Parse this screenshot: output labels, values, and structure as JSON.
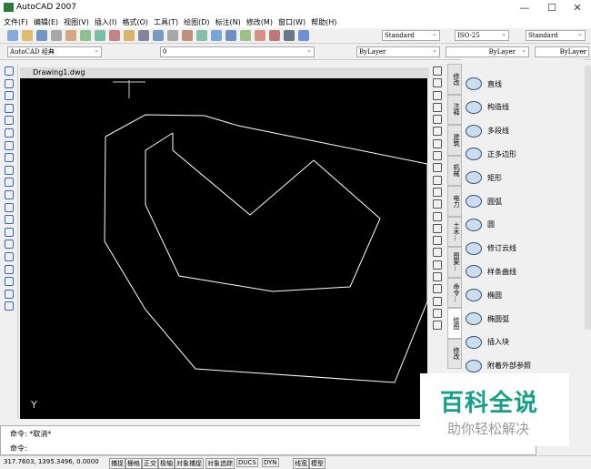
{
  "window": {
    "title": "AutoCAD 2007",
    "minimize": "—",
    "maximize": "☐",
    "close": "✕"
  },
  "menu": [
    "文件(F)",
    "编辑(E)",
    "视图(V)",
    "插入(I)",
    "格式(O)",
    "工具(T)",
    "绘图(D)",
    "标注(N)",
    "修改(M)",
    "窗口(W)",
    "帮助(H)"
  ],
  "toolbar": {
    "text_style": "Standard",
    "dim_style": "ISO-25",
    "table_style": "Standard",
    "workspace": "AutoCAD 经典",
    "layer": "0",
    "color": "ByLayer",
    "linetype": "ByLayer",
    "lineweight": "ByLayer"
  },
  "document": {
    "tab": "Drawing1.dwg",
    "ucs_y": "Y"
  },
  "palette": {
    "tabs": [
      "修改",
      "注释",
      "建筑",
      "机械",
      "电力",
      "土木...",
      "图案...",
      "命令...",
      "绘图",
      "修改"
    ],
    "active_tab": "绘图",
    "items": [
      "直线",
      "构造线",
      "多段线",
      "正多边形",
      "矩形",
      "圆弧",
      "圆",
      "修订云线",
      "样条曲线",
      "椭圆",
      "椭圆弧",
      "插入块",
      "附着外部参照"
    ]
  },
  "command": {
    "history": "命令: *取消*",
    "prompt": "命令:"
  },
  "status": {
    "coords": "317.7603,  1395.3496, 0.0000",
    "buttons": [
      "捕捉",
      "栅格",
      "正交",
      "极轴",
      "对象捕捉",
      "对象追踪",
      "DUCS",
      "DYN",
      "线宽",
      "模型"
    ]
  },
  "watermark": {
    "title": "百科全说",
    "subtitle": "助你轻松解决"
  }
}
